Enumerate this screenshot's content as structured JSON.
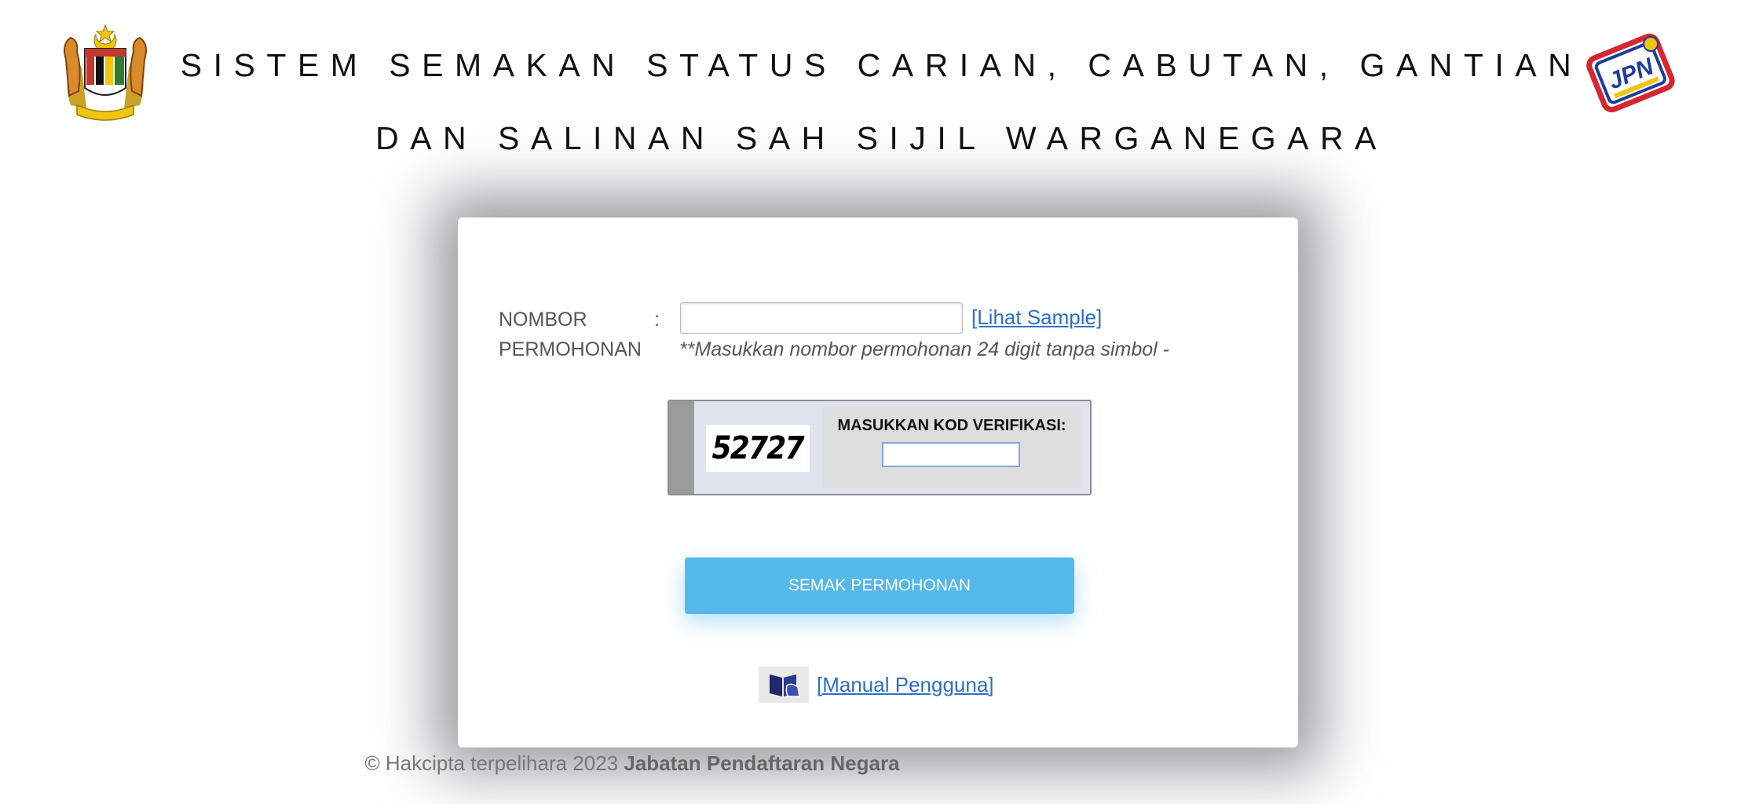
{
  "header": {
    "title_line1": "SISTEM SEMAKAN STATUS CARIAN, CABUTAN, GANTIAN",
    "title_line2": "DAN SALINAN SAH SIJIL WARGANEGARA",
    "left_logo": "malaysia-coat-of-arms",
    "right_logo_text": "JPN"
  },
  "form": {
    "nombor_label": "NOMBOR PERMOHONAN",
    "colon": ":",
    "nombor_value": "",
    "sample_link": "[Lihat Sample]",
    "hint": "**Masukkan nombor permohonan 24 digit tanpa simbol -"
  },
  "captcha": {
    "code": "52727",
    "label": "MASUKKAN KOD VERIFIKASI:",
    "input_value": ""
  },
  "submit_label": "SEMAK PERMOHONAN",
  "manual": {
    "icon": "book-hand-icon",
    "link_label": "[Manual Pengguna]"
  },
  "footer": {
    "copyright": "© Hakcipta terpelihara 2023",
    "org": "Jabatan Pendaftaran Negara"
  },
  "colors": {
    "button": "#55b8ea",
    "link": "#2a6fc9",
    "card_shadow": "#46485a"
  }
}
